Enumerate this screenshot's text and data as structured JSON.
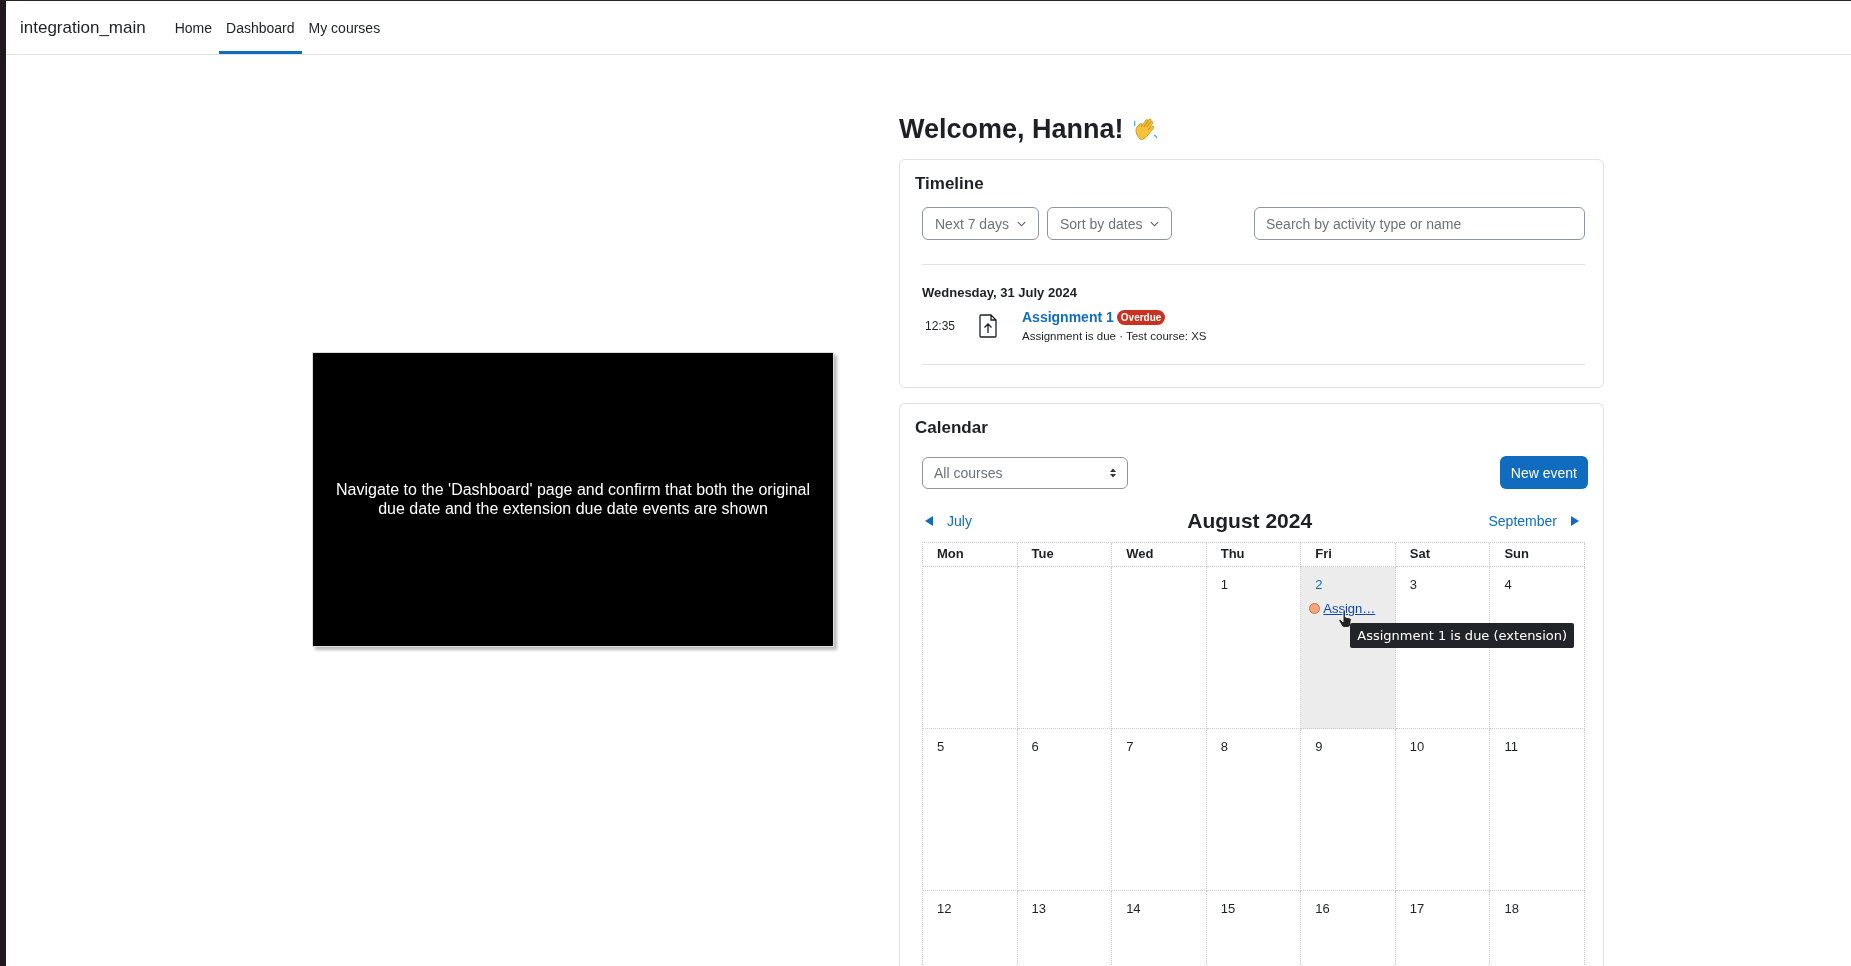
{
  "navbar": {
    "brand": "integration_main",
    "items": [
      {
        "label": "Home",
        "selected": false
      },
      {
        "label": "Dashboard",
        "selected": true
      },
      {
        "label": "My courses",
        "selected": false
      }
    ]
  },
  "overlay_caption": {
    "text": "Navigate to the 'Dashboard' page and confirm that both the original due date and the extension due date events are shown"
  },
  "welcome": {
    "title": "Welcome, Hanna!"
  },
  "timeline": {
    "title": "Timeline",
    "filters": [
      "Next 7 days",
      "Sort by dates"
    ],
    "search": {
      "placeholder": "Search by activity type or name"
    },
    "groups": [
      {
        "date": "Wednesday, 31 July 2024",
        "events": [
          {
            "time": "12:35",
            "name": "Assignment 1",
            "badge": "Overdue",
            "detail": "Assignment is due · Test course: XS"
          }
        ]
      }
    ]
  },
  "calendar": {
    "title": "Calendar",
    "course_select": "All courses",
    "new_event_button": "New event",
    "prev_month": "July",
    "month": "August 2024",
    "next_month": "September",
    "weekdays": [
      "Mon",
      "Tue",
      "Wed",
      "Thu",
      "Fri",
      "Sat",
      "Sun"
    ],
    "weeks": [
      [
        {
          "today": false
        },
        {
          "today": false
        },
        {
          "today": false
        },
        {
          "day": "1",
          "today": false
        },
        {
          "day": "2",
          "today": true,
          "events": [
            {
              "label": "Assign…",
              "color": "#f8a67e",
              "tooltip": "Assignment 1 is due (extension)"
            }
          ]
        },
        {
          "day": "3",
          "today": false
        },
        {
          "day": "4",
          "today": false
        }
      ],
      [
        {
          "day": "5",
          "today": false
        },
        {
          "day": "6",
          "today": false
        },
        {
          "day": "7",
          "today": false
        },
        {
          "day": "8",
          "today": false
        },
        {
          "day": "9",
          "today": false
        },
        {
          "day": "10",
          "today": false
        },
        {
          "day": "11",
          "today": false
        }
      ],
      [
        {
          "day": "12",
          "today": false
        },
        {
          "day": "13",
          "today": false
        },
        {
          "day": "14",
          "today": false
        },
        {
          "day": "15",
          "today": false
        },
        {
          "day": "16",
          "today": false
        },
        {
          "day": "17",
          "today": false
        },
        {
          "day": "18",
          "today": false
        }
      ]
    ]
  }
}
